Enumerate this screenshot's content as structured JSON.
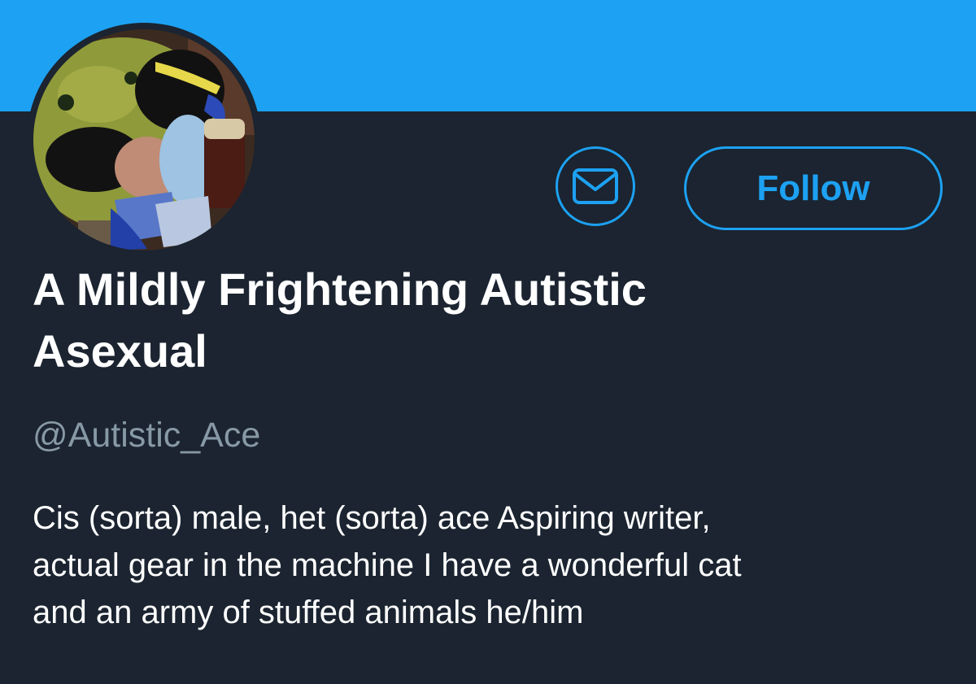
{
  "profile": {
    "display_name": "A Mildly Frightening Autistic\nAsexual",
    "handle": "@Autistic_Ace",
    "bio": "Cis (sorta) male, het (sorta) ace  Aspiring writer,\nactual gear in the machine  I have a wonderful cat\nand an army of stuffed animals  he/him"
  },
  "actions": {
    "message_icon": "envelope-icon",
    "follow_label": "Follow"
  },
  "colors": {
    "banner": "#1da1f2",
    "background": "#1b2430",
    "accent": "#1da1f2",
    "handle_text": "#8899a6"
  }
}
